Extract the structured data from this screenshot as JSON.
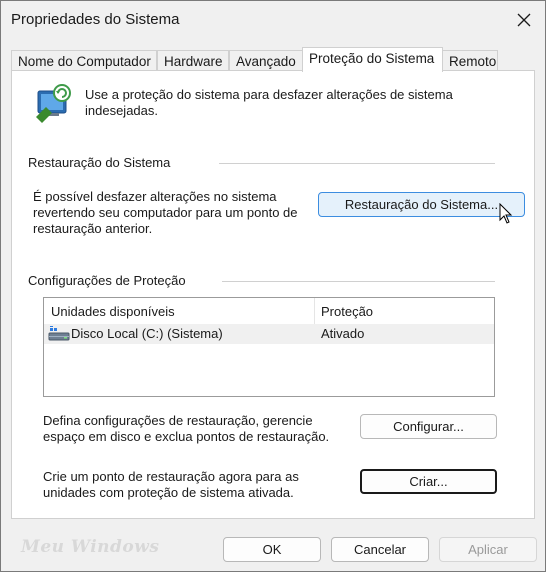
{
  "window": {
    "title": "Propriedades do Sistema"
  },
  "tabs": [
    {
      "label": "Nome do Computador"
    },
    {
      "label": "Hardware"
    },
    {
      "label": "Avançado"
    },
    {
      "label": "Proteção do Sistema",
      "active": true
    },
    {
      "label": "Remoto"
    }
  ],
  "intro": {
    "text": "Use a proteção do sistema para desfazer alterações de sistema indesejadas.",
    "icon": "system-protection-icon"
  },
  "restore_section": {
    "title": "Restauração do Sistema",
    "description": "É possível desfazer alterações no sistema revertendo seu computador para um ponto de restauração anterior.",
    "button_label": "Restauração do Sistema..."
  },
  "protection_section": {
    "title": "Configurações de Proteção",
    "columns": [
      "Unidades disponíveis",
      "Proteção"
    ],
    "rows": [
      {
        "drive": "Disco Local (C:) (Sistema)",
        "protection": "Ativado",
        "icon": "drive-icon"
      }
    ],
    "configure_text": "Defina configurações de restauração, gerencie espaço em disco e exclua pontos de restauração.",
    "configure_button": "Configurar...",
    "create_text": "Crie um ponto de restauração agora para as unidades com proteção de sistema ativada.",
    "create_button": "Criar..."
  },
  "footer": {
    "watermark": "Meu Windows",
    "ok": "OK",
    "cancel": "Cancelar",
    "apply": "Aplicar"
  }
}
